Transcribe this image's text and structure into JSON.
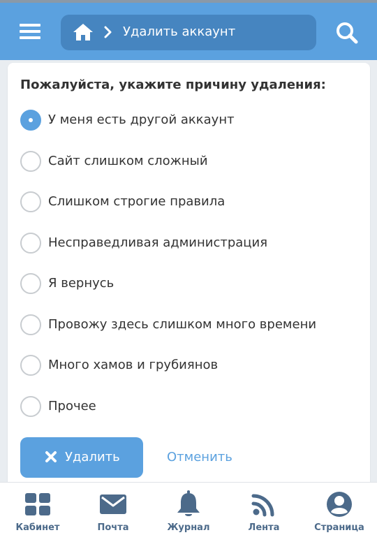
{
  "header": {
    "menu_icon": "hamburger-menu-icon",
    "home_icon": "home-icon",
    "separator_icon": "chevron-right-icon",
    "title": "Удалить аккаунт",
    "search_icon": "search-icon",
    "bar_color": "#5ba1df",
    "crumb_color": "#4685c0"
  },
  "form": {
    "question": "Пожалуйста, укажите причину удаления:",
    "options": [
      {
        "label": "У меня есть другой аккаунт",
        "selected": true
      },
      {
        "label": "Сайт слишком сложный",
        "selected": false
      },
      {
        "label": "Слишком строгие правила",
        "selected": false
      },
      {
        "label": "Несправедливая администрация",
        "selected": false
      },
      {
        "label": "Я вернусь",
        "selected": false
      },
      {
        "label": "Провожу здесь слишком много времени",
        "selected": false
      },
      {
        "label": "Много хамов и грубиянов",
        "selected": false
      },
      {
        "label": "Прочее",
        "selected": false
      }
    ],
    "delete_icon": "close-x-icon",
    "delete_label": "Удалить",
    "cancel_label": "Отменить",
    "accent_color": "#5ba1df"
  },
  "bottom_nav": {
    "items": [
      {
        "label": "Кабинет",
        "icon": "grid-icon"
      },
      {
        "label": "Почта",
        "icon": "mail-icon"
      },
      {
        "label": "Журнал",
        "icon": "bell-icon"
      },
      {
        "label": "Лента",
        "icon": "rss-feed-icon"
      },
      {
        "label": "Страница",
        "icon": "user-profile-icon"
      }
    ],
    "icon_color": "#4c6a8a"
  }
}
